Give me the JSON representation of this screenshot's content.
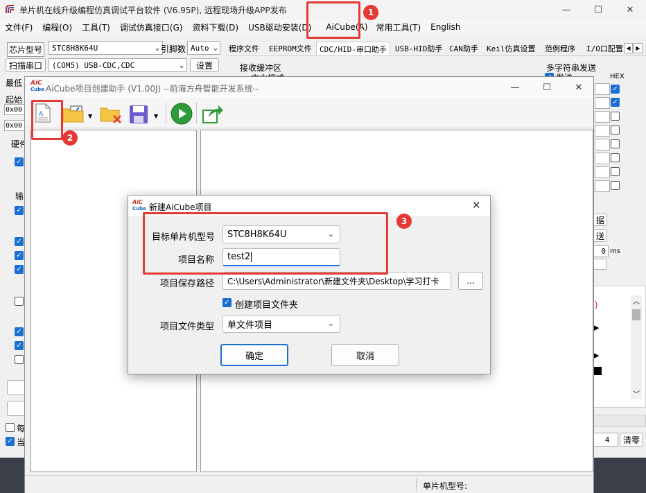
{
  "main_window": {
    "title": "单片机在线升级编程仿真调试平台软件 (V6.95P), 远程现场升级APP发布",
    "menu": [
      "文件(F)",
      "编程(O)",
      "工具(T)",
      "调试仿真接口(G)",
      "资料下载(D)",
      "USB驱动安装(D)",
      "AiCube(A)",
      "常用工具(T)",
      "English"
    ],
    "chip_label": "芯片型号",
    "chip_value": "STC8H8K64U",
    "pins_label": "引脚数",
    "pins_value": "Auto",
    "scan_button": "扫描串口",
    "port_value": "(COM5) USB-CDC,CDC",
    "settings_button": "设置",
    "left_labels": [
      "最低",
      "起始",
      "0x00",
      "0x00",
      "硬件",
      "输"
    ],
    "tabs": [
      "程序文件",
      "EEPROM文件",
      "CDC/HID-串口助手",
      "USB-HID助手",
      "CAN助手",
      "Keil仿真设置",
      "范例程序",
      "I/O口配置"
    ],
    "recv_label": "接收缓冲区",
    "recv_text_mode": "文本模式",
    "multi_send_label": "多字符串发送",
    "multi_send_col": "发送",
    "hex_label": "HEX",
    "frag_ju": "据",
    "frag_song": "送",
    "ms_value": "0",
    "ms_unit": "ms",
    "red_text": "F)",
    "bottom_count": "4",
    "clear_button": "清零",
    "bottom_left_1": "每",
    "bottom_left_2": "当"
  },
  "helper_window": {
    "title": "AiCube项目创建助手 (V1.00J) --前海方舟智能开发系统--",
    "status_label": "单片机型号:"
  },
  "dialog": {
    "title": "新建AiCube项目",
    "target_label": "目标单片机型号",
    "target_value": "STC8H8K64U",
    "name_label": "项目名称",
    "name_value": "test2",
    "path_label": "项目保存路径",
    "path_value": "C:\\Users\\Administrator\\新建文件夹\\Desktop\\学习打卡",
    "browse_button": "...",
    "create_folder_label": "创建项目文件夹",
    "type_label": "项目文件类型",
    "type_value": "单文件项目",
    "ok_button": "确定",
    "cancel_button": "取消"
  },
  "annotations": [
    "1",
    "2",
    "3"
  ],
  "icons": {
    "logo": "AiC",
    "logo_sub": "Cube"
  },
  "colors": {
    "accent": "#1a6fd0",
    "red": "#e53935",
    "green": "#2e9b3a"
  }
}
